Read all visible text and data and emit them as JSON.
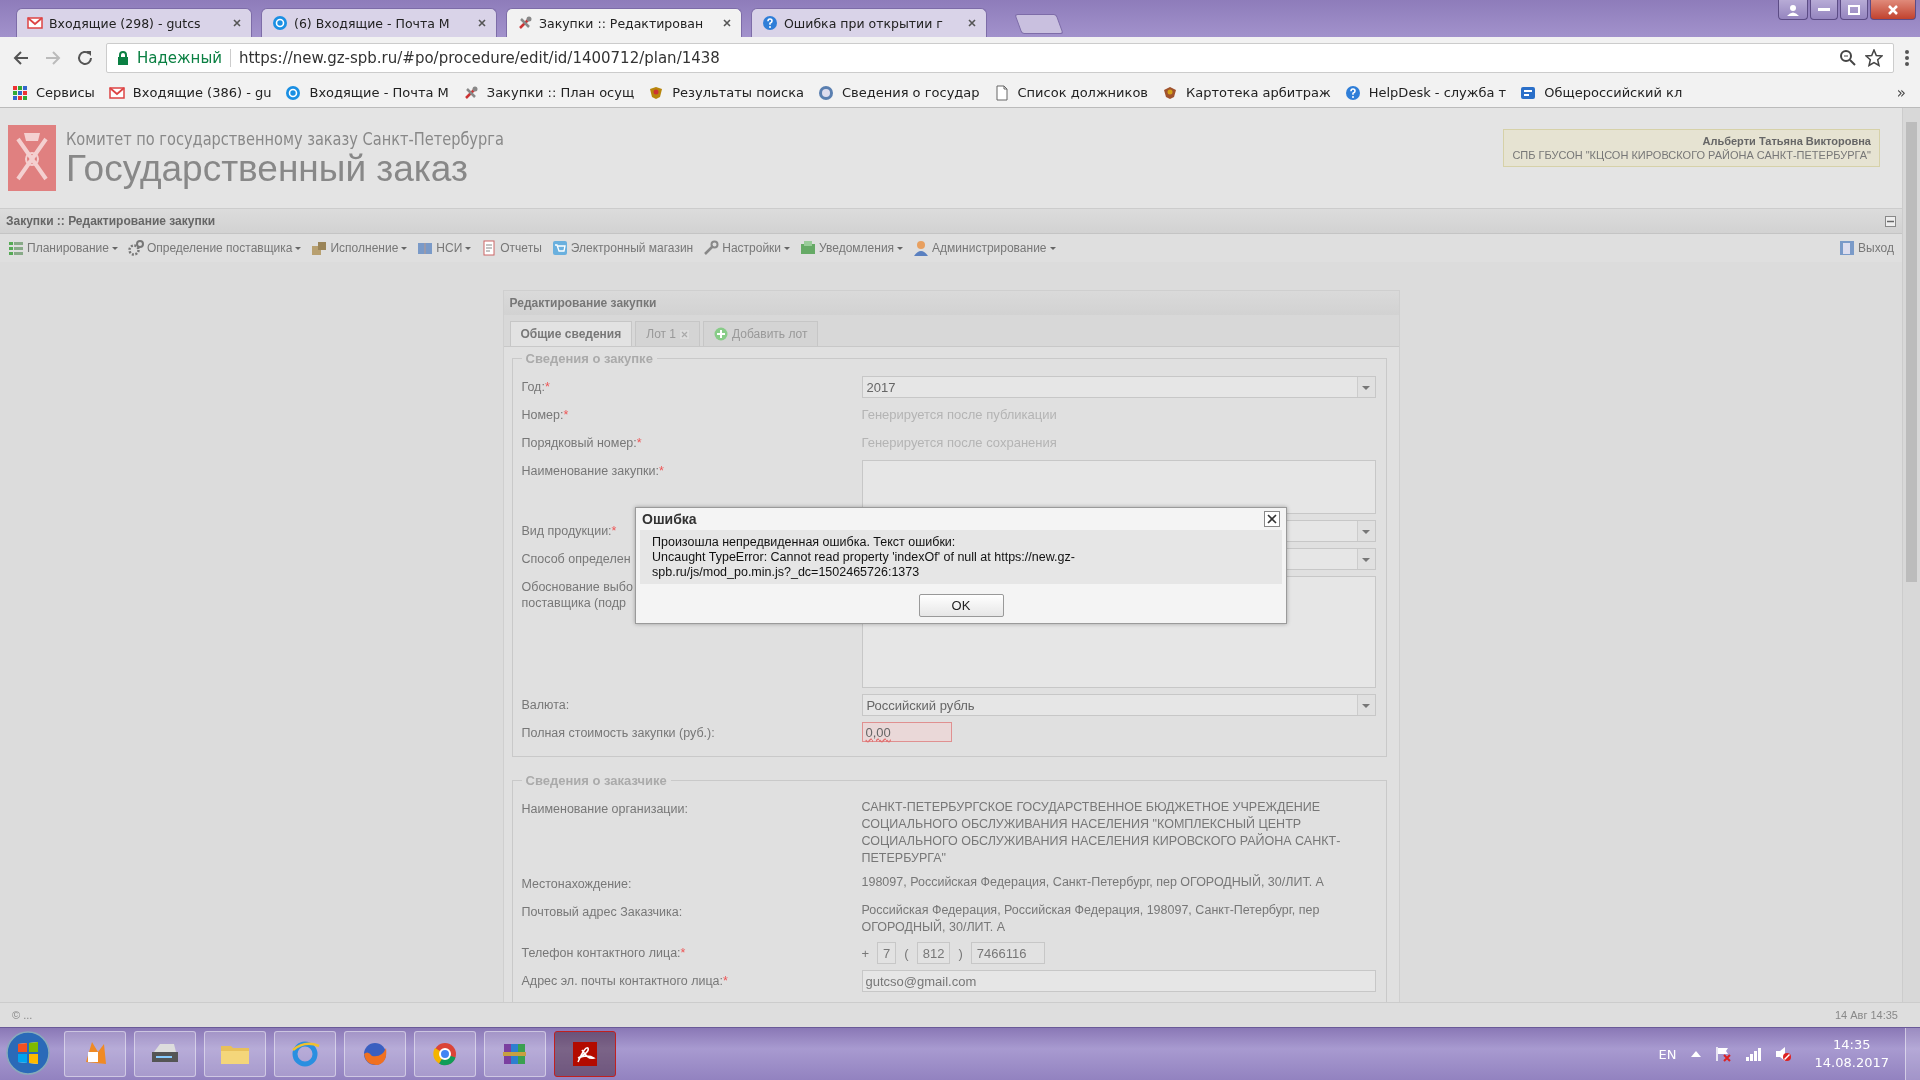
{
  "browser": {
    "tabs": [
      {
        "title": "Входящие (298) - gutcs",
        "selected": false
      },
      {
        "title": "(6) Входящие - Почта М",
        "selected": false
      },
      {
        "title": "Закупки :: Редактирован",
        "selected": true
      },
      {
        "title": "Ошибка при открытии г",
        "selected": false
      }
    ],
    "security_label": "Надежный",
    "url": "https://new.gz-spb.ru/#po/procedure/edit/id/1400712/plan/1438",
    "bookmarks": [
      "Сервисы",
      "Входящие (386) - gu",
      "Входящие - Почта М",
      "Закупки :: План осущ",
      "Результаты поиска",
      "Сведения о государ",
      "Список должников",
      "Картотека арбитраж",
      "HelpDesk - служба т",
      "Общероссийский кл"
    ],
    "bookmarks_overflow": "»"
  },
  "header": {
    "org_line": "Комитет по государственному заказу Санкт-Петербурга",
    "title": "Государственный заказ",
    "user_name": "Альберти Татьяна Викторовна",
    "user_org": "СПБ ГБУСОН \"КЦСОН КИРОВСКОГО РАЙОНА САНКТ-ПЕТЕРБУРГА\""
  },
  "panel_title": "Закупки :: Редактирование закупки",
  "menu": {
    "items": [
      {
        "label": "Планирование",
        "dropdown": true
      },
      {
        "label": "Определение поставщика",
        "dropdown": true
      },
      {
        "label": "Исполнение",
        "dropdown": true
      },
      {
        "label": "НСИ",
        "dropdown": true
      },
      {
        "label": "Отчеты",
        "dropdown": false
      },
      {
        "label": "Электронный магазин",
        "dropdown": false
      },
      {
        "label": "Настройки",
        "dropdown": true
      },
      {
        "label": "Уведомления",
        "dropdown": true
      },
      {
        "label": "Администрирование",
        "dropdown": true
      }
    ],
    "logout": "Выход"
  },
  "form": {
    "title": "Редактирование закупки",
    "tabs": [
      {
        "label": "Общие сведения",
        "selected": true,
        "closable": false
      },
      {
        "label": "Лот 1",
        "selected": false,
        "closable": true
      }
    ],
    "add_tab": "Добавить лот",
    "sections": [
      {
        "legend": "Сведения о закупке",
        "fields": [
          {
            "label": "Год:",
            "required_mark": "*",
            "kind": "combo",
            "value": "2017"
          },
          {
            "label": "Номер:",
            "required_mark": "*",
            "kind": "auto",
            "value": "Генерируется после публикации"
          },
          {
            "label": "Порядковый номер:",
            "required_mark": "*",
            "kind": "auto",
            "value": "Генерируется после сохранения"
          },
          {
            "label": "Наименование закупки:",
            "required_mark": "*",
            "kind": "textarea"
          },
          {
            "label": "Вид продукции:",
            "required_mark": "*",
            "kind": "combo"
          },
          {
            "label": "Способ определен",
            "kind": "combo"
          },
          {
            "label": "Обоснование выбо\nпоставщика (подр",
            "kind": "memo"
          },
          {
            "label": "Валюта:",
            "kind": "combo",
            "value": "Российский рубль"
          },
          {
            "label": "Полная стоимость закупки (руб.):",
            "kind": "money",
            "value": "0,00",
            "invalid": true
          }
        ]
      },
      {
        "legend": "Сведения о заказчике",
        "fields": [
          {
            "label": "Наименование организации:",
            "kind": "text",
            "value": "САНКТ-ПЕТЕРБУРГСКОЕ ГОСУДАРСТВЕННОЕ БЮДЖЕТНОЕ УЧРЕЖДЕНИЕ СОЦИАЛЬНОГО ОБСЛУЖИВАНИЯ НАСЕЛЕНИЯ \"КОМПЛЕКСНЫЙ ЦЕНТР СОЦИАЛЬНОГО ОБСЛУЖИВАНИЯ НАСЕЛЕНИЯ КИРОВСКОГО РАЙОНА САНКТ-ПЕТЕРБУРГА\""
          },
          {
            "label": "Местонахождение:",
            "kind": "text",
            "value": "198097, Российская Федерация, Санкт-Петербург, пер ОГОРОДНЫЙ, 30/ЛИТ. А"
          },
          {
            "label": "Почтовый адрес Заказчика:",
            "kind": "text",
            "value": "Российская Федерация, Российская Федерация, 198097, Санкт-Петербург, пер ОГОРОДНЫЙ, 30/ЛИТ. А"
          },
          {
            "label": "Телефон контактного лица:",
            "required_mark": "*",
            "kind": "phone",
            "parts": [
              {
                "kind": "sep",
                "text": "+"
              },
              {
                "kind": "box",
                "text": "7"
              },
              {
                "kind": "sep",
                "text": "("
              },
              {
                "kind": "box",
                "text": "812"
              },
              {
                "kind": "sep",
                "text": ")"
              },
              {
                "kind": "wide",
                "text": "7466116"
              }
            ]
          },
          {
            "label": "Адрес эл. почты контактного лица:",
            "required_mark": "*",
            "kind": "field",
            "value": "gutcso@gmail.com"
          }
        ]
      }
    ]
  },
  "dialog": {
    "title": "Ошибка",
    "message": [
      "Произошла непредвиденная ошибка. Текст ошибки:",
      "Uncaught TypeError: Cannot read property 'indexOf' of null at https://new.gz-spb.ru/js/mod_po.min.js?_dc=1502465726:1373"
    ],
    "button": "OK"
  },
  "status_bar": {
    "left": "© ...",
    "right": "14 Авг 14:35"
  },
  "taskbar": {
    "language": "EN",
    "time": "14:35",
    "date": "14.08.2017"
  }
}
